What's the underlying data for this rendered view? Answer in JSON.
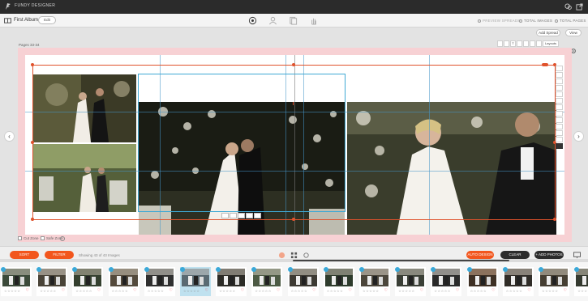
{
  "app": {
    "brand": "FUNDY DESIGNER"
  },
  "header": {
    "album_name": "First Album",
    "edit_label": "Edit",
    "stats": [
      {
        "label": "PREVIEW SPREADS",
        "dim": true
      },
      {
        "label": "TOTAL IMAGES",
        "dim": false
      },
      {
        "label": "TOTAL PAGES",
        "dim": false
      }
    ]
  },
  "workspace": {
    "add_spread_label": "Add Spread",
    "view_label": "View",
    "pages_label": "Pages 33-34",
    "layout_tools": [
      "",
      "",
      "T",
      "",
      "",
      "",
      "",
      "Layouts"
    ],
    "cut_zone_label": "Cut Zone",
    "safe_zone_label": "Safe Zone"
  },
  "bottom_bar": {
    "sort_label": "SORT",
    "filter_label": "FILTER",
    "showing_text": "Showing 43 of 43 Images",
    "autodesign_label": "AUTO DESIGN",
    "clear_label": "CLEAR",
    "add_photos_label": "+ ADD PHOTOS"
  },
  "filmstrip": {
    "thumbnails": [
      {
        "stars": "☆☆☆☆☆",
        "badge": true,
        "selected": false
      },
      {
        "stars": "☆☆☆☆☆",
        "badge": true,
        "selected": false
      },
      {
        "stars": "☆☆☆☆☆",
        "badge": true,
        "selected": false
      },
      {
        "stars": "☆☆☆☆☆",
        "badge": true,
        "selected": false
      },
      {
        "stars": "☆☆☆☆☆",
        "badge": true,
        "selected": false
      },
      {
        "stars": "☆☆☆☆☆",
        "badge": true,
        "selected": true
      },
      {
        "stars": "☆☆☆☆☆",
        "badge": true,
        "selected": false
      },
      {
        "stars": "☆☆☆☆☆",
        "badge": true,
        "selected": false
      },
      {
        "stars": "☆☆☆☆☆",
        "badge": true,
        "selected": false
      },
      {
        "stars": "☆☆☆☆☆",
        "badge": true,
        "selected": false
      },
      {
        "stars": "☆☆☆☆☆",
        "badge": true,
        "selected": false
      },
      {
        "stars": "☆☆☆☆☆",
        "badge": true,
        "selected": false
      },
      {
        "stars": "☆☆☆☆☆",
        "badge": true,
        "selected": false
      },
      {
        "stars": "☆☆☆☆☆",
        "badge": true,
        "selected": false
      },
      {
        "stars": "☆☆☆☆☆",
        "badge": true,
        "selected": false
      },
      {
        "stars": "☆☆☆☆☆",
        "badge": true,
        "selected": false
      },
      {
        "stars": "☆☆☆☆☆",
        "badge": true,
        "selected": false
      }
    ]
  },
  "colors": {
    "accent": "#f2561d",
    "selection": "#3fa9d4",
    "bleed": "#f7d1d4"
  },
  "icons": [
    "fundy-logo-icon",
    "chat-icon",
    "export-icon",
    "album-icon",
    "design-icon",
    "proof-icon",
    "pages-icon",
    "hand-icon",
    "gear-icon",
    "chevron-left-icon",
    "chevron-right-icon",
    "help-icon",
    "eraser-icon",
    "grid-icon",
    "settings-icon",
    "monitor-icon"
  ]
}
